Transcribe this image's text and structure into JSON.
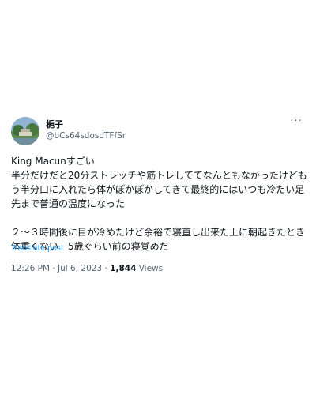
{
  "user": {
    "display_name": "梔子",
    "handle": "@bCs64sdosdTFfSr"
  },
  "tweet": {
    "text": "King Macunすごい\n半分だけだと20分ストレッチや筋トレしててなんともなかったけどもう半分口に入れたら体がぽかぽかしてきて最終的にはいつも冷たい足先まで普通の温度になった\n\n２〜３時間後に目が冷めたけど余裕で寝直し出来た上に朝起きたとき体重くない　5歳ぐらい前の寝覚めだ",
    "translate_label": "Translate post",
    "time": "12:26 PM",
    "date": "Jul 6, 2023",
    "separator": "·",
    "views_count": "1,844",
    "views_label": "Views"
  },
  "icons": {
    "more": "more-dots-icon",
    "avatar": "avatar-landscape-photo"
  },
  "colors": {
    "link": "#1d9bf0",
    "secondary_text": "#536471",
    "primary_text": "#0f1419"
  }
}
